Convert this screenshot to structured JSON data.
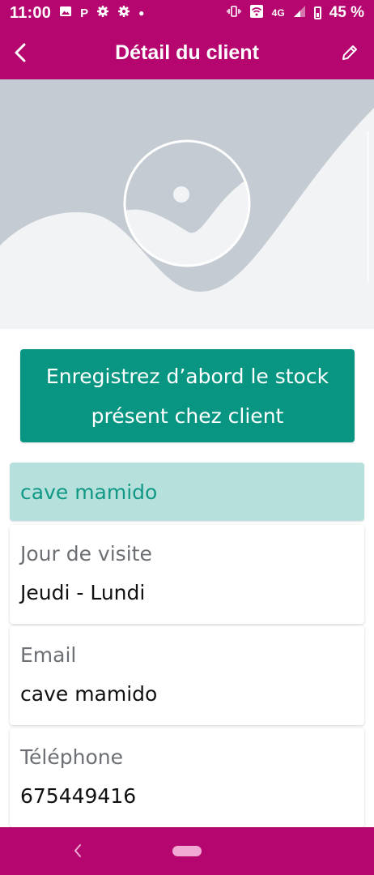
{
  "status_bar": {
    "time": "11:00",
    "left_icons": [
      "image-icon",
      "parking-icon",
      "gear-icon",
      "gear-icon"
    ],
    "parking_glyph": "P",
    "network": "4G",
    "battery": "45 %"
  },
  "app_bar": {
    "title": "Détail du client"
  },
  "cta": {
    "label": "Enregistrez d’abord le stock présent chez client"
  },
  "client": {
    "name": "cave mamido",
    "fields": [
      {
        "label": "Jour de visite",
        "value": "Jeudi - Lundi"
      },
      {
        "label": "Email",
        "value": "cave mamido"
      },
      {
        "label": "Téléphone",
        "value": "675449416"
      }
    ]
  },
  "colors": {
    "brand": "#b4066e",
    "accent": "#089683",
    "header_tint": "#b5e0dc",
    "accent_text": "#119885"
  }
}
